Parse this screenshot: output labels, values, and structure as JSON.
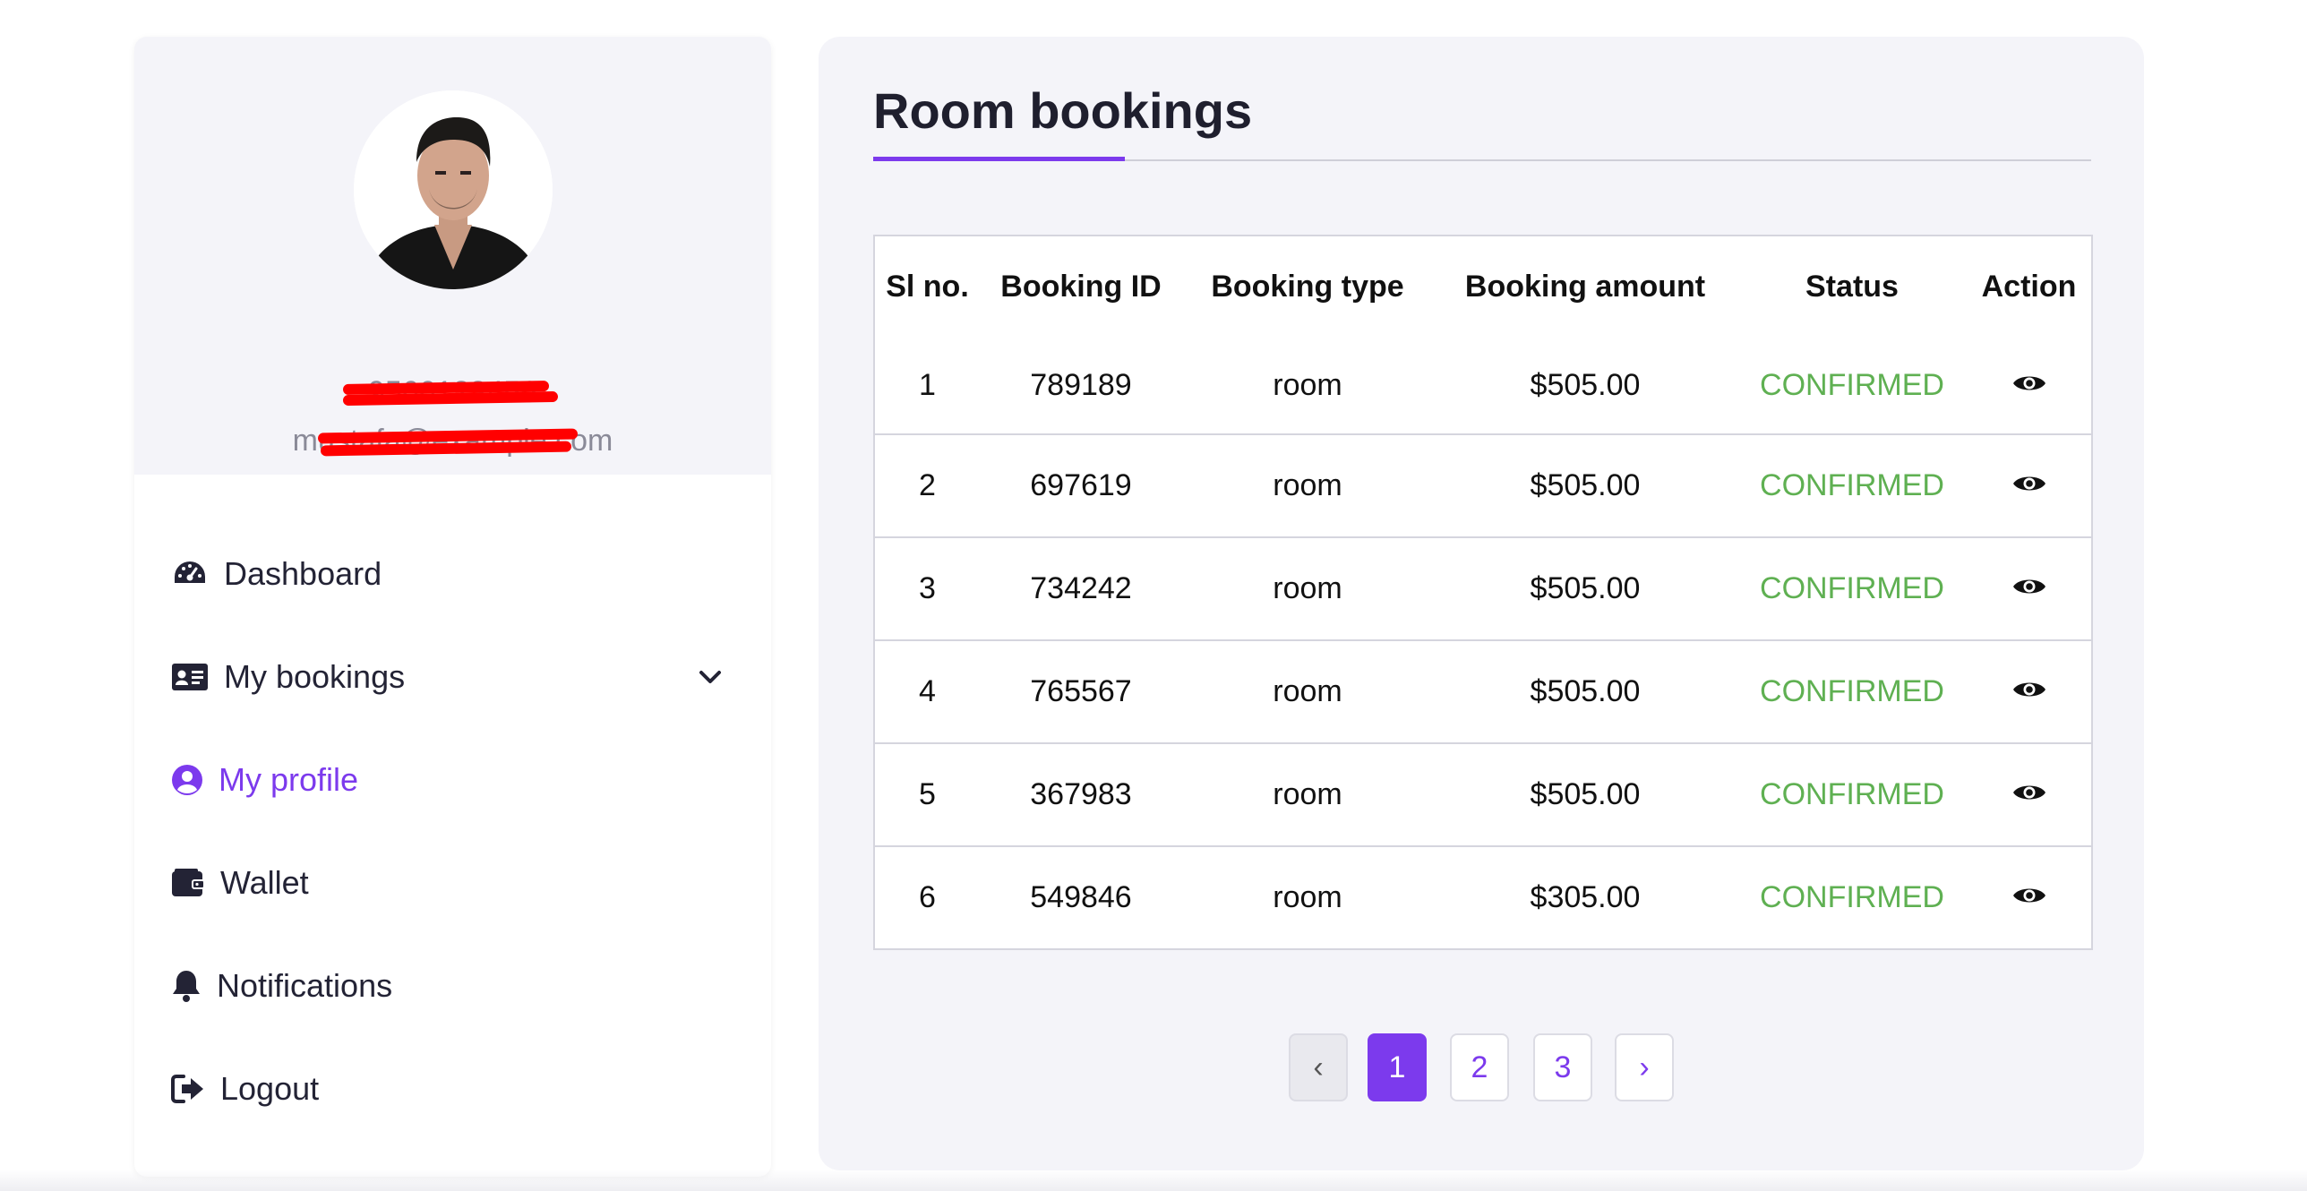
{
  "user": {
    "phone": "9566123456",
    "email": "mustafa@example.com"
  },
  "nav": {
    "items": [
      {
        "label": "Dashboard",
        "icon": "speedometer-icon"
      },
      {
        "label": "My bookings",
        "icon": "id-card-icon",
        "has_dropdown": true
      },
      {
        "label": "My profile",
        "icon": "user-circle-icon",
        "active": true
      },
      {
        "label": "Wallet",
        "icon": "wallet-icon"
      },
      {
        "label": "Notifications",
        "icon": "bell-icon"
      },
      {
        "label": "Logout",
        "icon": "logout-icon"
      }
    ]
  },
  "main": {
    "title": "Room bookings",
    "table": {
      "headers": [
        "Sl no.",
        "Booking ID",
        "Booking type",
        "Booking amount",
        "Status",
        "Action"
      ],
      "rows": [
        {
          "sl": "1",
          "id": "789189",
          "type": "room",
          "amount": "$505.00",
          "status": "CONFIRMED"
        },
        {
          "sl": "2",
          "id": "697619",
          "type": "room",
          "amount": "$505.00",
          "status": "CONFIRMED"
        },
        {
          "sl": "3",
          "id": "734242",
          "type": "room",
          "amount": "$505.00",
          "status": "CONFIRMED"
        },
        {
          "sl": "4",
          "id": "765567",
          "type": "room",
          "amount": "$505.00",
          "status": "CONFIRMED"
        },
        {
          "sl": "5",
          "id": "367983",
          "type": "room",
          "amount": "$505.00",
          "status": "CONFIRMED"
        },
        {
          "sl": "6",
          "id": "549846",
          "type": "room",
          "amount": "$305.00",
          "status": "CONFIRMED"
        }
      ]
    },
    "pagination": {
      "prev": "‹",
      "pages": [
        "1",
        "2",
        "3"
      ],
      "current": "1",
      "next": "›"
    }
  },
  "colors": {
    "accent": "#7c3aed",
    "confirmed": "#5fb052",
    "panel_bg": "#f4f4f9"
  }
}
